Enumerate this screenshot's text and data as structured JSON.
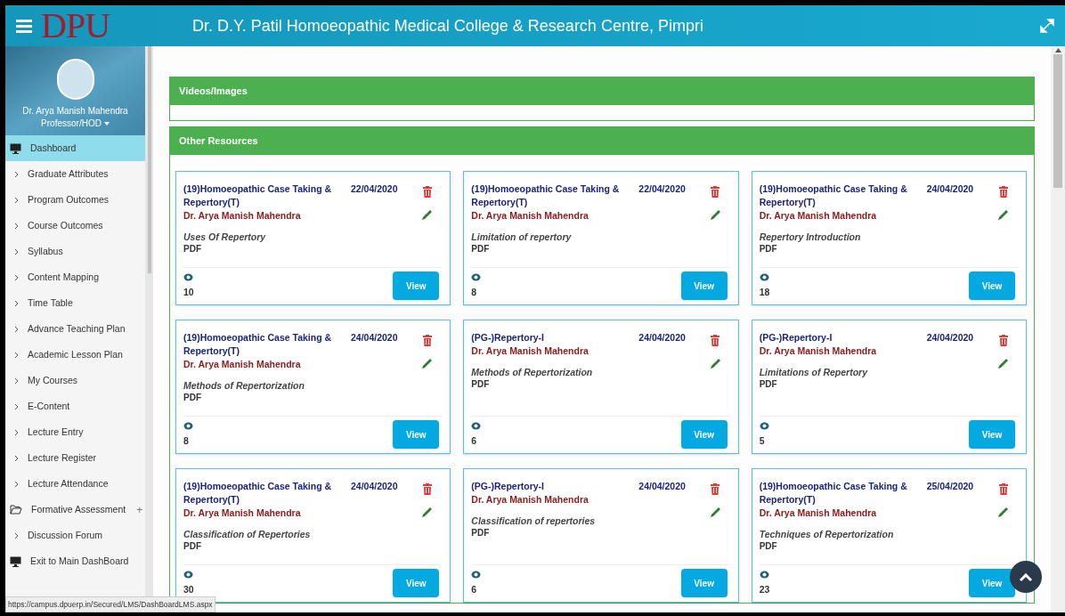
{
  "header": {
    "logo": "DPU",
    "title": "Dr. D.Y. Patil Homoeopathic Medical College & Research Centre, Pimpri"
  },
  "profile": {
    "name": "Dr. Arya Manish Mahendra",
    "role": "Professor/HOD"
  },
  "sidebar": {
    "items": [
      {
        "label": "Dashboard",
        "kind": "monitor",
        "selected": true
      },
      {
        "label": "Graduate Attributes",
        "kind": "chevron",
        "selected": false
      },
      {
        "label": "Program Outcomes",
        "kind": "chevron",
        "selected": false
      },
      {
        "label": "Course Outcomes",
        "kind": "chevron",
        "selected": false
      },
      {
        "label": "Syllabus",
        "kind": "chevron",
        "selected": false
      },
      {
        "label": "Content Mapping",
        "kind": "chevron",
        "selected": false
      },
      {
        "label": "Time Table",
        "kind": "chevron",
        "selected": false
      },
      {
        "label": "Advance Teaching Plan",
        "kind": "chevron",
        "selected": false
      },
      {
        "label": "Academic Lesson Plan",
        "kind": "chevron",
        "selected": false
      },
      {
        "label": "My Courses",
        "kind": "chevron",
        "selected": false
      },
      {
        "label": "E-Content",
        "kind": "chevron",
        "selected": false
      },
      {
        "label": "Lecture Entry",
        "kind": "chevron",
        "selected": false
      },
      {
        "label": "Lecture Register",
        "kind": "chevron",
        "selected": false
      },
      {
        "label": "Lecture Attendance",
        "kind": "chevron",
        "selected": false
      },
      {
        "label": "Formative Assessment",
        "kind": "folder",
        "expander": "+",
        "selected": false
      },
      {
        "label": "Discussion Forum",
        "kind": "chevron",
        "selected": false
      },
      {
        "label": "Exit to Main DashBoard",
        "kind": "monitor",
        "selected": false
      }
    ]
  },
  "sections": [
    {
      "title": "Videos/Images"
    },
    {
      "title": "Other Resources"
    }
  ],
  "cards": [
    {
      "course": "(19)Homoeopathic Case Taking & Repertory(T)",
      "date": "22/04/2020",
      "author": "Dr. Arya Manish Mahendra",
      "topic": "Uses Of Repertory",
      "type": "PDF",
      "views": "10",
      "button": "View"
    },
    {
      "course": "(19)Homoeopathic Case Taking & Repertory(T)",
      "date": "22/04/2020",
      "author": "Dr. Arya Manish Mahendra",
      "topic": "Limitation of repertory",
      "type": "PDF",
      "views": "8",
      "button": "View"
    },
    {
      "course": "(19)Homoeopathic Case Taking & Repertory(T)",
      "date": "24/04/2020",
      "author": "Dr. Arya Manish Mahendra",
      "topic": "Repertory Introduction",
      "type": "PDF",
      "views": "18",
      "button": "View"
    },
    {
      "course": "(19)Homoeopathic Case Taking & Repertory(T)",
      "date": "24/04/2020",
      "author": "Dr. Arya Manish Mahendra",
      "topic": "Methods of Repertorization",
      "type": "PDF",
      "views": "8",
      "button": "View"
    },
    {
      "course": "(PG-)Repertory-I",
      "date": "24/04/2020",
      "author": "Dr. Arya Manish Mahendra",
      "topic": "Methods of Repertorization",
      "type": "PDF",
      "views": "6",
      "button": "View"
    },
    {
      "course": "(PG-)Repertory-I",
      "date": "24/04/2020",
      "author": "Dr. Arya Manish Mahendra",
      "topic": "Limitations of Repertory",
      "type": "PDF",
      "views": "5",
      "button": "View"
    },
    {
      "course": "(19)Homoeopathic Case Taking & Repertory(T)",
      "date": "24/04/2020",
      "author": "Dr. Arya Manish Mahendra",
      "topic": "Classification of Repertories",
      "type": "PDF",
      "views": "30",
      "button": "View"
    },
    {
      "course": "(PG-)Repertory-I",
      "date": "24/04/2020",
      "author": "Dr. Arya Manish Mahendra",
      "topic": "Classification of repertories",
      "type": "PDF",
      "views": "6",
      "button": "View"
    },
    {
      "course": "(19)Homoeopathic Case Taking & Repertory(T)",
      "date": "25/04/2020",
      "author": "Dr. Arya Manish Mahendra",
      "topic": "Techniques of Repertorization",
      "type": "PDF",
      "views": "23",
      "button": "View"
    }
  ],
  "status_bar": {
    "url": "https://campus.dpuerp.in/Secured/LMS/DashBoardLMS.aspx"
  }
}
